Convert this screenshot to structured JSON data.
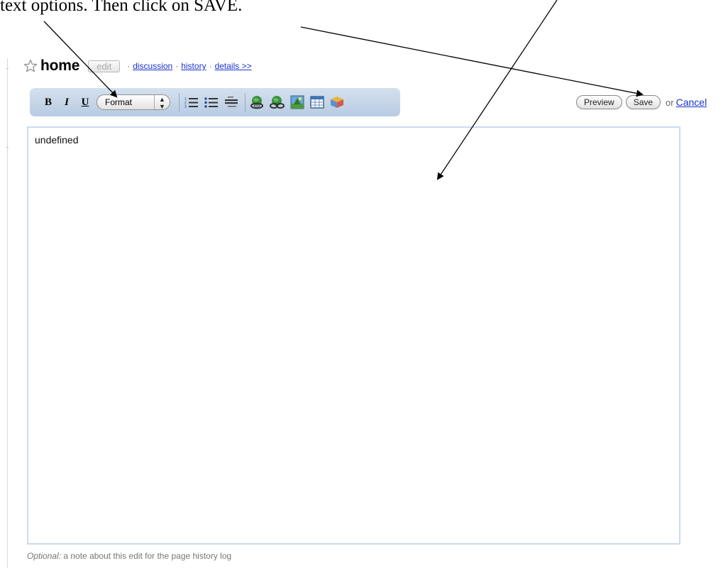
{
  "instruction": {
    "text": "text options.   Then click on SAVE."
  },
  "page": {
    "title": "home"
  },
  "header": {
    "edit_label": "edit",
    "sep": "·",
    "links": [
      "discussion",
      "history",
      "details >>"
    ]
  },
  "toolbar": {
    "bold_label": "B",
    "italic_label": "I",
    "underline_label": "U",
    "format_label": "Format",
    "icons": [
      "numbered-list-icon",
      "bullet-list-icon",
      "definition-list-icon",
      "link-icon",
      "unlink-icon",
      "image-icon",
      "table-icon",
      "special-char-icon"
    ]
  },
  "actions": {
    "preview_label": "Preview",
    "save_label": "Save",
    "or_label": "or",
    "cancel_label": "Cancel"
  },
  "editor": {
    "content": "undefined"
  },
  "note": {
    "prefix": "Optional:",
    "text": " a note about this edit for the page history log"
  },
  "colors": {
    "link": "#1a33cc",
    "toolbar": "#c6d6ea",
    "editor_border": "#c9dbf0"
  }
}
